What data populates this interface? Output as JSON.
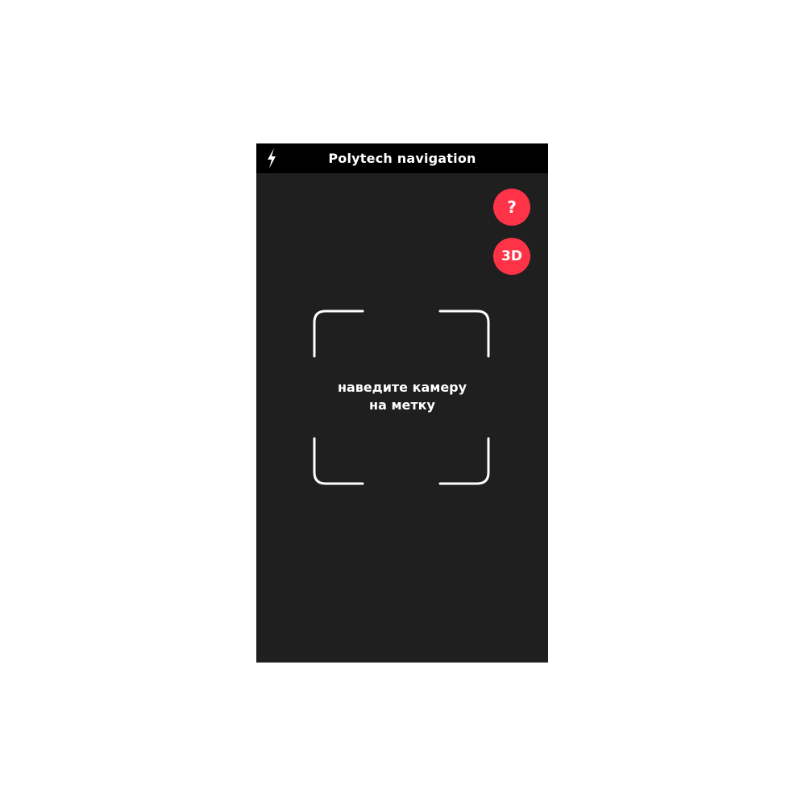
{
  "app": {
    "title": "Polytech navigation"
  },
  "topbar": {
    "flash_icon": "lightning-bolt-icon"
  },
  "buttons": {
    "help_label": "?",
    "view3d_label": "3D"
  },
  "scanner": {
    "hint_line1": "наведите камеру",
    "hint_line2": "на метку"
  },
  "colors": {
    "background": "#1f1f1f",
    "topbar": "#000000",
    "accent": "#ff3347",
    "text": "#ffffff"
  }
}
